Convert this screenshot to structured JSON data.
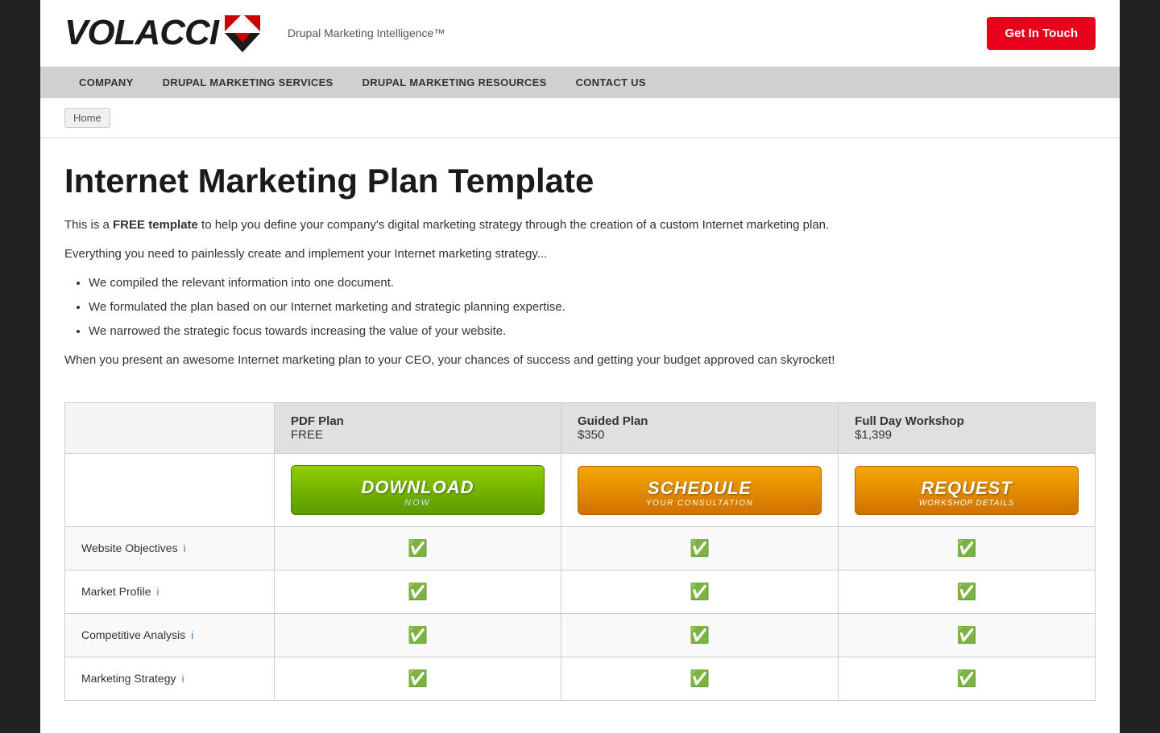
{
  "header": {
    "logo_brand": "VOLACCI",
    "logo_tagline": "Drupal Marketing Intelligence™",
    "cta_button": "Get In Touch"
  },
  "nav": {
    "items": [
      {
        "label": "COMPANY"
      },
      {
        "label": "DRUPAL MARKETING SERVICES"
      },
      {
        "label": "DRUPAL MARKETING RESOURCES"
      },
      {
        "label": "CONTACT US"
      }
    ]
  },
  "breadcrumb": {
    "items": [
      {
        "label": "Home"
      }
    ]
  },
  "main": {
    "page_title": "Internet Marketing Plan Template",
    "intro_line1_prefix": "This is a ",
    "intro_line1_bold": "FREE template",
    "intro_line1_suffix": " to help you define your company's digital marketing strategy through the creation of a custom Internet marketing plan.",
    "intro_line2": "Everything you need to painlessly create and implement your Internet marketing strategy...",
    "bullets": [
      "We compiled the relevant information into one document.",
      "We formulated the plan based on our Internet marketing and strategic planning expertise.",
      "We narrowed the strategic focus towards increasing the value of your website."
    ],
    "closing_text": "When you present an awesome Internet marketing plan to your CEO, your chances of success and getting your budget approved can skyrocket!"
  },
  "pricing_table": {
    "columns": [
      {
        "label": "",
        "sub": ""
      },
      {
        "label": "PDF Plan",
        "sub": "FREE"
      },
      {
        "label": "Guided Plan",
        "sub": "$350"
      },
      {
        "label": "Full Day Workshop",
        "sub": "$1,399"
      }
    ],
    "buttons": [
      {
        "type": "download",
        "main": "DOWNLOAD",
        "sub": "NOW"
      },
      {
        "type": "schedule",
        "main": "SCHEDULE",
        "sub": "YOUR CONSULTATION"
      },
      {
        "type": "request",
        "main": "REQUEST",
        "sub": "WORKSHOP DETAILS"
      }
    ],
    "features": [
      {
        "label": "Website Objectives",
        "info": "i",
        "col1": true,
        "col2": true,
        "col3": true
      },
      {
        "label": "Market Profile",
        "info": "i",
        "col1": true,
        "col2": true,
        "col3": true
      },
      {
        "label": "Competitive Analysis",
        "info": "i",
        "col1": true,
        "col2": true,
        "col3": true
      },
      {
        "label": "Marketing Strategy",
        "info": "i",
        "col1": true,
        "col2": true,
        "col3": true
      }
    ]
  }
}
